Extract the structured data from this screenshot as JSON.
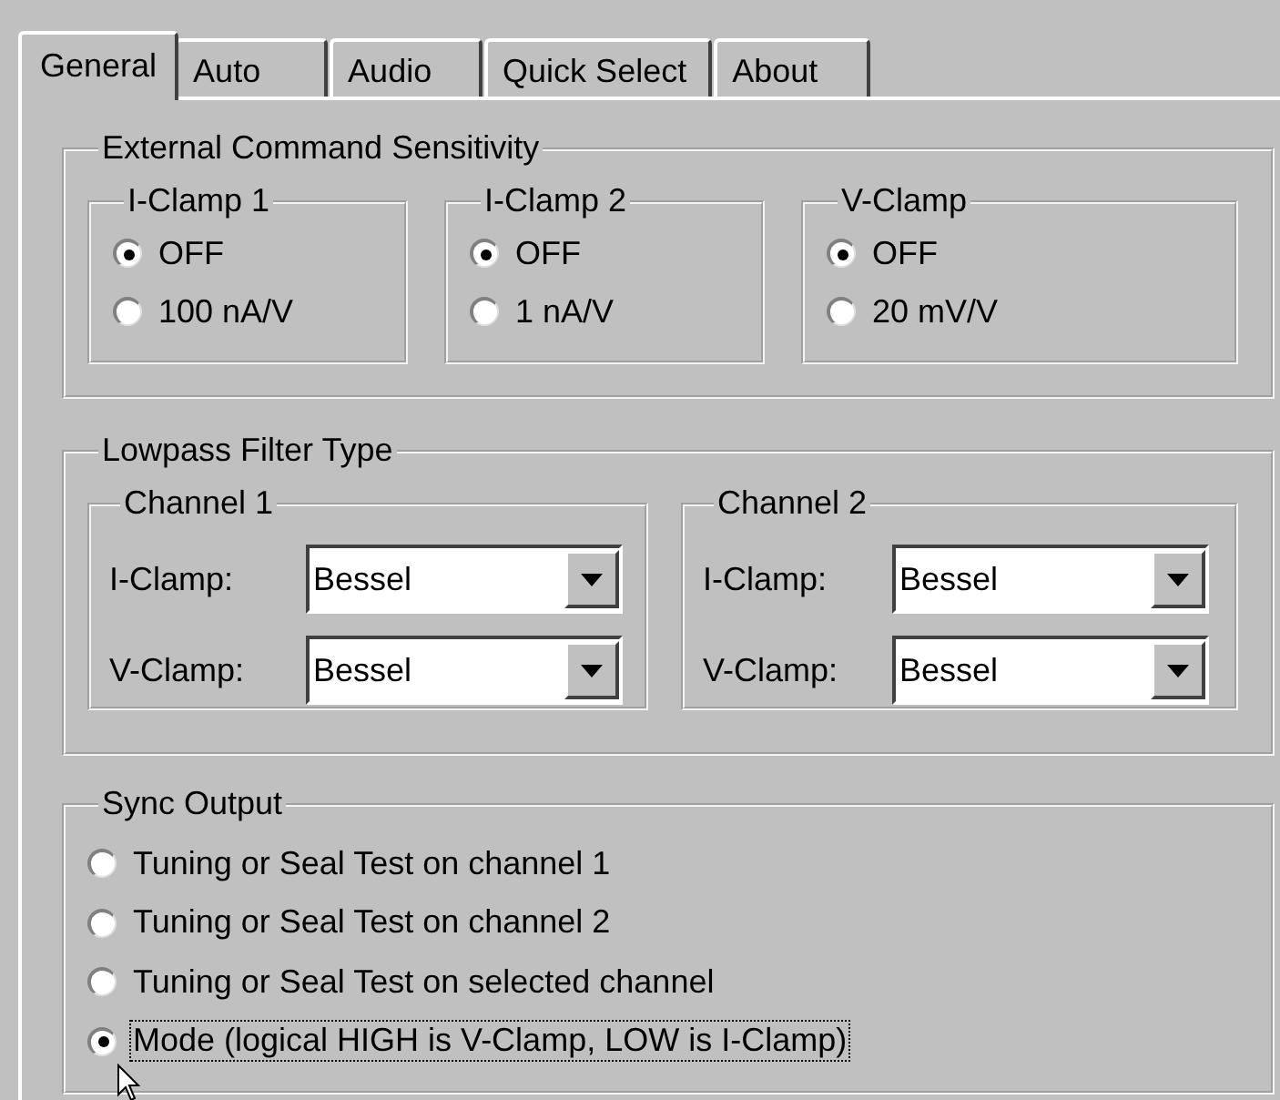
{
  "tabs": [
    {
      "label": "General",
      "selected": true
    },
    {
      "label": "Auto",
      "selected": false
    },
    {
      "label": "Audio",
      "selected": false
    },
    {
      "label": "Quick Select",
      "selected": false
    },
    {
      "label": "About",
      "selected": false
    }
  ],
  "external_command_sensitivity": {
    "title": "External Command Sensitivity",
    "groups": [
      {
        "title": "I-Clamp 1",
        "options": [
          {
            "label": "OFF",
            "selected": true
          },
          {
            "label": "100 nA/V",
            "selected": false
          }
        ]
      },
      {
        "title": "I-Clamp 2",
        "options": [
          {
            "label": "OFF",
            "selected": true
          },
          {
            "label": "1 nA/V",
            "selected": false
          }
        ]
      },
      {
        "title": "V-Clamp",
        "options": [
          {
            "label": "OFF",
            "selected": true
          },
          {
            "label": "20 mV/V",
            "selected": false
          }
        ]
      }
    ]
  },
  "lowpass_filter_type": {
    "title": "Lowpass Filter Type",
    "channels": [
      {
        "title": "Channel 1",
        "rows": [
          {
            "label": "I-Clamp:",
            "value": "Bessel"
          },
          {
            "label": "V-Clamp:",
            "value": "Bessel"
          }
        ]
      },
      {
        "title": "Channel 2",
        "rows": [
          {
            "label": "I-Clamp:",
            "value": "Bessel"
          },
          {
            "label": "V-Clamp:",
            "value": "Bessel"
          }
        ]
      }
    ]
  },
  "sync_output": {
    "title": "Sync Output",
    "options": [
      {
        "label": "Tuning or Seal Test on channel 1",
        "selected": false,
        "focused": false
      },
      {
        "label": "Tuning or Seal Test on channel 2",
        "selected": false,
        "focused": false
      },
      {
        "label": "Tuning or Seal Test on selected channel",
        "selected": false,
        "focused": false
      },
      {
        "label": "Mode (logical HIGH is V-Clamp, LOW is I-Clamp)",
        "selected": true,
        "focused": true
      }
    ]
  }
}
